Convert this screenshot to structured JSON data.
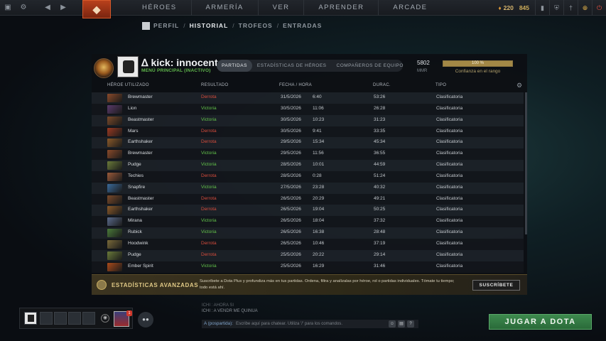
{
  "topnav": {
    "items": [
      "HÉROES",
      "ARMERÍA",
      "VER",
      "APRENDER",
      "ARCADE"
    ],
    "shards_value": "220",
    "gold_value": "845"
  },
  "subnav": {
    "items": [
      "PERFIL",
      "HISTORIAL",
      "TROFEOS",
      "ENTRADAS"
    ],
    "separator": "/"
  },
  "profile": {
    "name": "kick: innocent",
    "status": "MENÚ PRINCIPAL (INACTIVO)",
    "tabs": [
      "PARTIDAS",
      "ESTADÍSTICAS DE HÉROES",
      "COMPAÑEROS DE EQUIPO"
    ],
    "mmr_value": "5802",
    "mmr_label": "MMR",
    "confidence_value": "100 %",
    "confidence_fraction": 1.0,
    "confidence_label": "Confianza en el rango"
  },
  "table": {
    "headers": [
      "HÉROE UTILIZADO",
      "RESULTADO",
      "FECHA / HORA",
      "DURAC.",
      "TIPO"
    ],
    "rows": [
      {
        "hero": "Brewmaster",
        "result": "Derrota",
        "date": "31/5/2026",
        "time": "6:40",
        "duration": "53:26",
        "type": "Clasificatoria",
        "color": "#8a4a2a"
      },
      {
        "hero": "Lion",
        "result": "Victoria",
        "date": "30/5/2026",
        "time": "11:06",
        "duration": "26:28",
        "type": "Clasificatoria",
        "color": "#5a3a6a"
      },
      {
        "hero": "Beastmaster",
        "result": "Victoria",
        "date": "30/5/2026",
        "time": "10:23",
        "duration": "31:23",
        "type": "Clasificatoria",
        "color": "#7a4a2a"
      },
      {
        "hero": "Mars",
        "result": "Derrota",
        "date": "30/5/2026",
        "time": "9:41",
        "duration": "33:35",
        "type": "Clasificatoria",
        "color": "#9a3a22"
      },
      {
        "hero": "Earthshaker",
        "result": "Derrota",
        "date": "29/5/2026",
        "time": "15:34",
        "duration": "45:34",
        "type": "Clasificatoria",
        "color": "#8a5a2a"
      },
      {
        "hero": "Brewmaster",
        "result": "Victoria",
        "date": "29/5/2026",
        "time": "11:56",
        "duration": "36:55",
        "type": "Clasificatoria",
        "color": "#8a4a2a"
      },
      {
        "hero": "Pudge",
        "result": "Victoria",
        "date": "28/5/2026",
        "time": "10:01",
        "duration": "44:59",
        "type": "Clasificatoria",
        "color": "#6a7a3a"
      },
      {
        "hero": "Techies",
        "result": "Derrota",
        "date": "28/5/2026",
        "time": "0:28",
        "duration": "51:24",
        "type": "Clasificatoria",
        "color": "#9a5a3a"
      },
      {
        "hero": "Snapfire",
        "result": "Victoria",
        "date": "27/5/2026",
        "time": "23:28",
        "duration": "40:32",
        "type": "Clasificatoria",
        "color": "#3a6a9a"
      },
      {
        "hero": "Beastmaster",
        "result": "Derrota",
        "date": "26/5/2026",
        "time": "20:29",
        "duration": "49:21",
        "type": "Clasificatoria",
        "color": "#7a4a2a"
      },
      {
        "hero": "Earthshaker",
        "result": "Derrota",
        "date": "26/5/2026",
        "time": "19:04",
        "duration": "50:25",
        "type": "Clasificatoria",
        "color": "#8a5a2a"
      },
      {
        "hero": "Mirana",
        "result": "Victoria",
        "date": "26/5/2026",
        "time": "18:04",
        "duration": "37:32",
        "type": "Clasificatoria",
        "color": "#5a6a8a"
      },
      {
        "hero": "Rubick",
        "result": "Victoria",
        "date": "26/5/2026",
        "time": "16:38",
        "duration": "28:48",
        "type": "Clasificatoria",
        "color": "#4a7a3a"
      },
      {
        "hero": "Hoodwink",
        "result": "Derrota",
        "date": "26/5/2026",
        "time": "10:46",
        "duration": "37:19",
        "type": "Clasificatoria",
        "color": "#7a6a3a"
      },
      {
        "hero": "Pudge",
        "result": "Derrota",
        "date": "25/5/2026",
        "time": "20:22",
        "duration": "29:14",
        "type": "Clasificatoria",
        "color": "#6a7a3a"
      },
      {
        "hero": "Ember Spirit",
        "result": "Victoria",
        "date": "25/5/2026",
        "time": "16:29",
        "duration": "31:46",
        "type": "Clasificatoria",
        "color": "#aa4a1a"
      }
    ]
  },
  "advanced": {
    "title": "ESTADÍSTICAS AVANZADAS",
    "text": "Suscríbete a Dota Plus y profundiza más en tus partidas. Ordena, filtra y analízalas por héroe, rol o partidas individuales. Tómate tu tiempo; todo está ahí.",
    "button": "SUSCRÍBETE"
  },
  "chat": {
    "lines": [
      "ICHI : AHORA SI",
      "ICHI : A VENDR ME QUINUA"
    ],
    "channel": "A (pospartida):",
    "placeholder": "Escribe aquí para chatear. Utiliza '/' para los comandos."
  },
  "party": {
    "badge": "1"
  },
  "play_button": "JUGAR A DOTA"
}
